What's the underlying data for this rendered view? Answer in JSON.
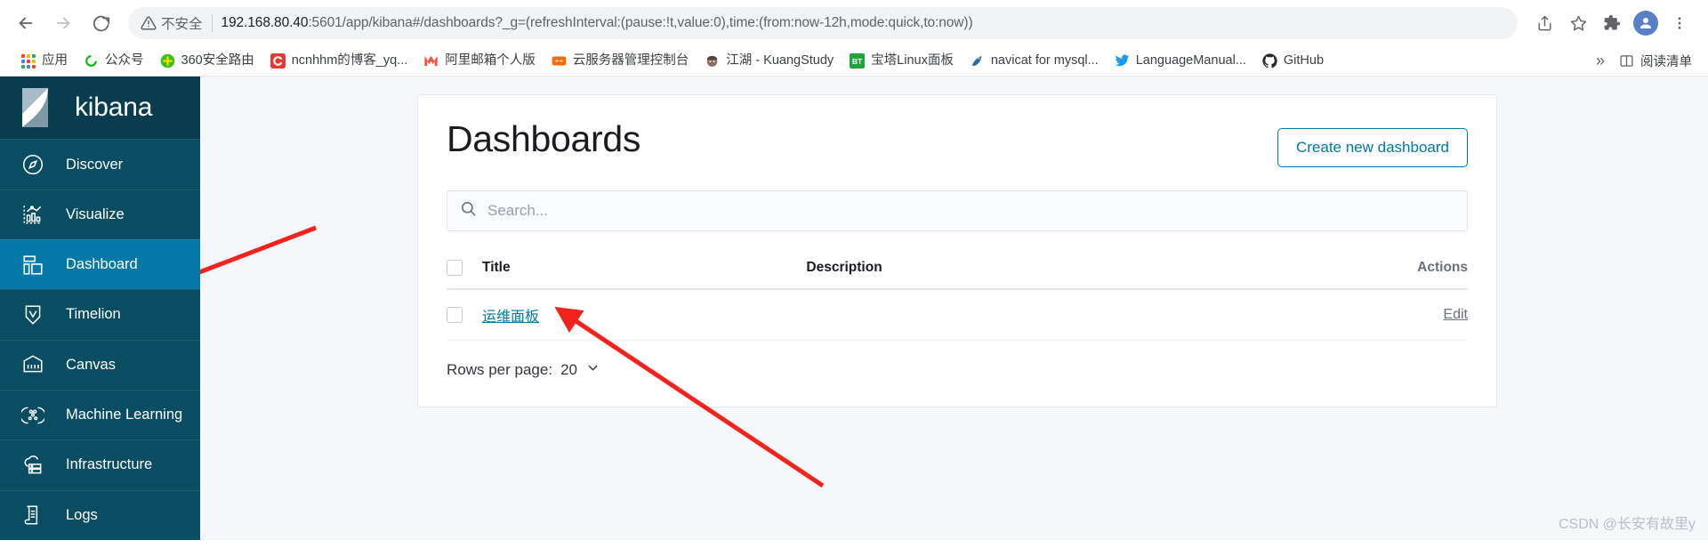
{
  "browser": {
    "nav": {
      "back_label": "Back",
      "forward_label": "Forward",
      "reload_label": "Reload"
    },
    "omnibox": {
      "security_label": "不安全",
      "url_host": "192.168.80.40",
      "url_rest": ":5601/app/kibana#/dashboards?_g=(refreshInterval:(pause:!t,value:0),time:(from:now-12h,mode:quick,to:now))",
      "full_url": "192.168.80.40:5601/app/kibana#/dashboards?_g=(refreshInterval:(pause:!t,value:0),time:(from:now-12h,mode:quick,to:now))",
      "share_label": "分享",
      "bookmark_label": "收藏",
      "extensions_label": "扩展程序",
      "profile_initial": "",
      "menu_label": "更多"
    },
    "bookmarks": [
      {
        "label": "应用",
        "icon": "apps-grid-icon"
      },
      {
        "label": "公众号",
        "icon": "wechat-official-icon"
      },
      {
        "label": "360安全路由",
        "icon": "360-router-icon"
      },
      {
        "label": "ncnhhm的博客_yq...",
        "icon": "csdn-icon"
      },
      {
        "label": "阿里邮箱个人版",
        "icon": "alimail-icon"
      },
      {
        "label": "云服务器管理控制台",
        "icon": "aliyun-console-icon"
      },
      {
        "label": "江湖 - KuangStudy",
        "icon": "kuangstudy-icon"
      },
      {
        "label": "宝塔Linux面板",
        "icon": "bt-panel-icon"
      },
      {
        "label": "navicat for mysql...",
        "icon": "navicat-icon"
      },
      {
        "label": "LanguageManual...",
        "icon": "twitter-icon"
      },
      {
        "label": "GitHub",
        "icon": "github-icon"
      }
    ],
    "bookmark_overflow_label": "»",
    "reading_list_label": "阅读清单"
  },
  "sidebar": {
    "logo_text": "kibana",
    "items": [
      {
        "label": "Discover",
        "icon": "compass-icon",
        "active": false
      },
      {
        "label": "Visualize",
        "icon": "chart-icon",
        "active": false
      },
      {
        "label": "Dashboard",
        "icon": "dashboard-icon",
        "active": true
      },
      {
        "label": "Timelion",
        "icon": "timelion-icon",
        "active": false
      },
      {
        "label": "Canvas",
        "icon": "canvas-icon",
        "active": false
      },
      {
        "label": "Machine Learning",
        "icon": "ml-icon",
        "active": false
      },
      {
        "label": "Infrastructure",
        "icon": "infra-icon",
        "active": false
      },
      {
        "label": "Logs",
        "icon": "logs-icon",
        "active": false
      }
    ]
  },
  "page": {
    "title": "Dashboards",
    "create_button": "Create new dashboard",
    "search_placeholder": "Search...",
    "search_value": "",
    "table": {
      "columns": [
        "Title",
        "Description",
        "Actions"
      ],
      "rows": [
        {
          "title": "运维面板",
          "description": "",
          "action": "Edit"
        }
      ]
    },
    "rows_per_page_label": "Rows per page:",
    "rows_per_page_value": "20"
  },
  "watermark": "CSDN @长安有故里y",
  "colors": {
    "sidebar_bg": "#0a4d63",
    "sidebar_logo_bg": "#083c4e",
    "sidebar_active": "#0479a8",
    "accent_link": "#0079a5",
    "annotation_arrow": "#f2231f",
    "page_bg": "#f5f7fa"
  }
}
